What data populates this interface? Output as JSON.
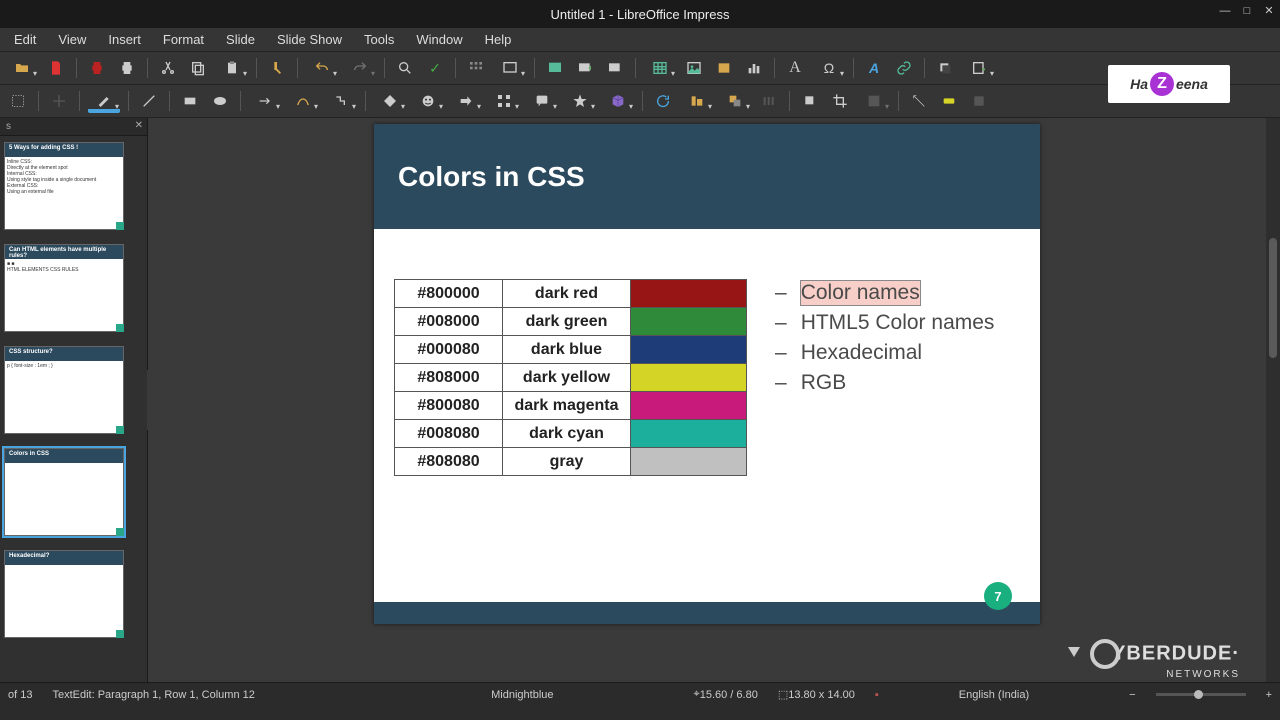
{
  "window": {
    "title": "Untitled 1 - LibreOffice Impress"
  },
  "menus": [
    "Edit",
    "View",
    "Insert",
    "Format",
    "Slide",
    "Slide Show",
    "Tools",
    "Window",
    "Help"
  ],
  "panel": {
    "header": "s",
    "slides": [
      {
        "title": "5 Ways for adding CSS !",
        "body": "Inline CSS:\n  Directly at the element spot\nInternal CSS:\n  Using style tag inside a single document\nExternal CSS:\n  Using an external file"
      },
      {
        "title": "Can HTML elements have multiple rules?",
        "body": "■ ■\nHTML ELEMENTS     CSS RULES"
      },
      {
        "title": "CSS structure?",
        "body": "p { font-size : 1em ; }"
      },
      {
        "title": "Colors in CSS",
        "body": ""
      },
      {
        "title": "Hexadecimal?",
        "body": ""
      }
    ]
  },
  "slide": {
    "title": "Colors in CSS",
    "page_number": "7",
    "colors": [
      {
        "hex": "#800000",
        "name": "dark red",
        "swatch": "#971515"
      },
      {
        "hex": "#008000",
        "name": "dark green",
        "swatch": "#2f8a3a"
      },
      {
        "hex": "#000080",
        "name": "dark blue",
        "swatch": "#1d3c78"
      },
      {
        "hex": "#808000",
        "name": "dark yellow",
        "swatch": "#d3d426"
      },
      {
        "hex": "#800080",
        "name": "dark magenta",
        "swatch": "#c71a7b"
      },
      {
        "hex": "#008080",
        "name": "dark cyan",
        "swatch": "#1caf9b"
      },
      {
        "hex": "#808080",
        "name": "gray",
        "swatch": "#c0c0c0"
      }
    ],
    "bullets": [
      {
        "text": "Color names",
        "selected": true
      },
      {
        "text": "HTML5 Color names",
        "selected": false
      },
      {
        "text": "Hexadecimal",
        "selected": false
      },
      {
        "text": "RGB",
        "selected": false
      }
    ]
  },
  "status": {
    "slide_of": "of 13",
    "edit_mode": "TextEdit: Paragraph 1, Row 1, Column 12",
    "color_label": "Midnightblue",
    "pos": "15.60 / 6.80",
    "size": "13.80 x 14.00",
    "language": "English (India)"
  },
  "watermark": {
    "top_left": "Ha",
    "top_right": "eena",
    "top_badge": "Z",
    "bottom_main": "YBERDUDE",
    "bottom_sub": "NETWORKS"
  }
}
